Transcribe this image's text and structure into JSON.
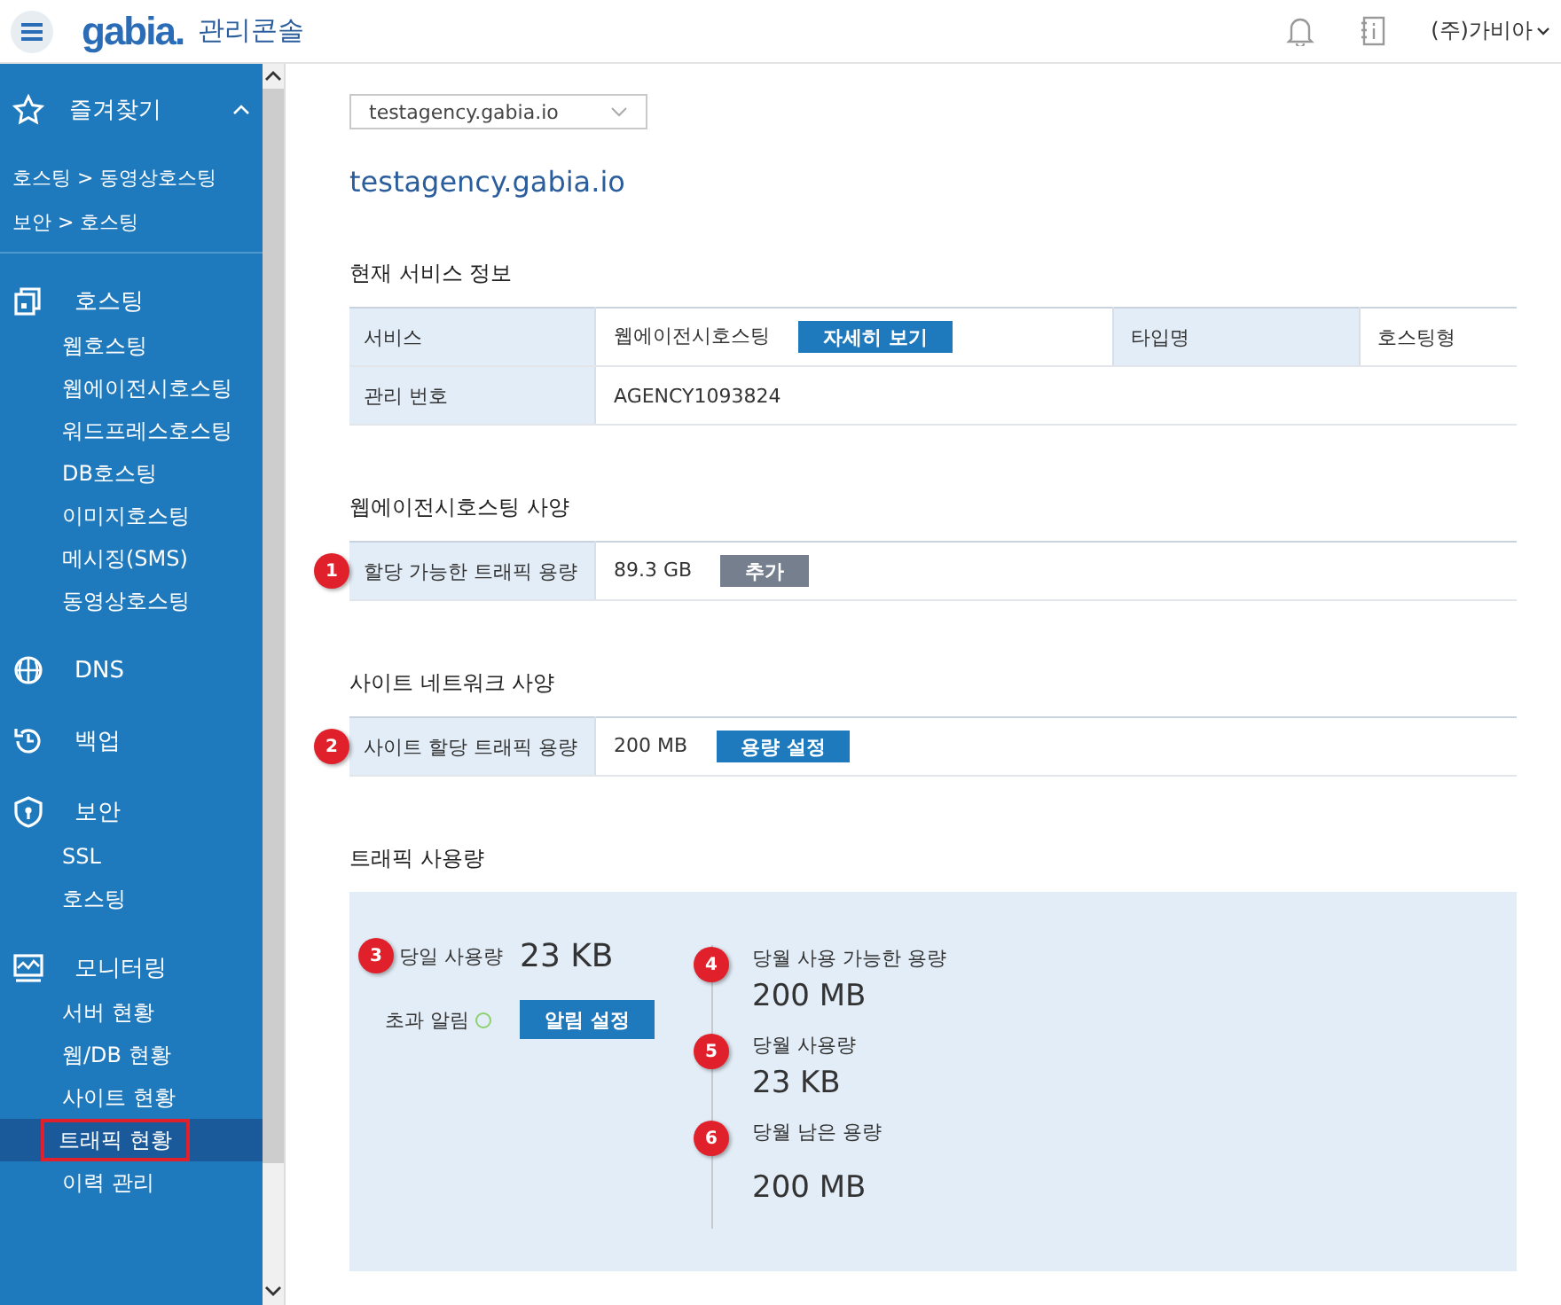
{
  "header": {
    "logo": "gabia.",
    "title": "관리콘솔",
    "account": "(주)가비아"
  },
  "sidebar": {
    "favorites": {
      "label": "즐겨찾기",
      "expanded": true,
      "items": [
        "호스팅 > 동영상호스팅",
        "보안 > 호스팅"
      ]
    },
    "groups": [
      {
        "label": "호스팅",
        "children": [
          {
            "label": "웹호스팅",
            "selected": false
          },
          {
            "label": "웹에이전시호스팅",
            "selected": false
          },
          {
            "label": "워드프레스호스팅",
            "selected": false
          },
          {
            "label": "DB호스팅",
            "selected": false
          },
          {
            "label": "이미지호스팅",
            "selected": false
          },
          {
            "label": "메시징(SMS)",
            "selected": false
          },
          {
            "label": "동영상호스팅",
            "selected": false
          }
        ]
      },
      {
        "label": "DNS"
      },
      {
        "label": "백업"
      },
      {
        "label": "보안",
        "children": [
          {
            "label": "SSL",
            "selected": false
          },
          {
            "label": "호스팅",
            "selected": false
          }
        ]
      },
      {
        "label": "모니터링",
        "children": [
          {
            "label": "서버 현황",
            "selected": false
          },
          {
            "label": "웹/DB 현황",
            "selected": false
          },
          {
            "label": "사이트 현황",
            "selected": false
          },
          {
            "label": "트래픽 현황",
            "selected": true
          },
          {
            "label": "이력 관리",
            "selected": false
          }
        ]
      }
    ]
  },
  "main": {
    "domain_select": "testagency.gabia.io",
    "domain_title": "testagency.gabia.io",
    "service_info": {
      "title": "현재 서비스 정보",
      "rows": [
        [
          {
            "label": "서비스",
            "value": "웹에이전시호스팅",
            "button": "자세히 보기"
          },
          {
            "label": "타입명",
            "value": "호스팅형"
          }
        ],
        [
          {
            "label": "관리 번호",
            "value": "AGENCY1093824"
          }
        ]
      ]
    },
    "spec": {
      "title": "웹에이전시호스팅 사양",
      "marker": "1",
      "label": "할당 가능한 트래픽 용량",
      "value": "89.3 GB",
      "button": {
        "label": "추가",
        "kind": "secondary"
      }
    },
    "network": {
      "title": "사이트 네트워크 사양",
      "marker": "2",
      "label": "사이트 할당 트래픽 용량",
      "value": "200 MB",
      "button": {
        "label": "용량 설정",
        "kind": "primary"
      }
    },
    "traffic": {
      "title": "트래픽 사용량",
      "today": {
        "marker": "3",
        "label": "당일 사용량",
        "value": "23 KB"
      },
      "alert": {
        "label": "초과 알림",
        "active": false,
        "button": "알림 설정"
      },
      "stats": [
        {
          "marker": "4",
          "label": "당월 사용 가능한 용량",
          "value": "200 MB"
        },
        {
          "marker": "5",
          "label": "당월 사용량",
          "value": "23 KB"
        },
        {
          "marker": "6",
          "label": "당월 남은 용량",
          "value": "200 MB"
        }
      ]
    }
  }
}
